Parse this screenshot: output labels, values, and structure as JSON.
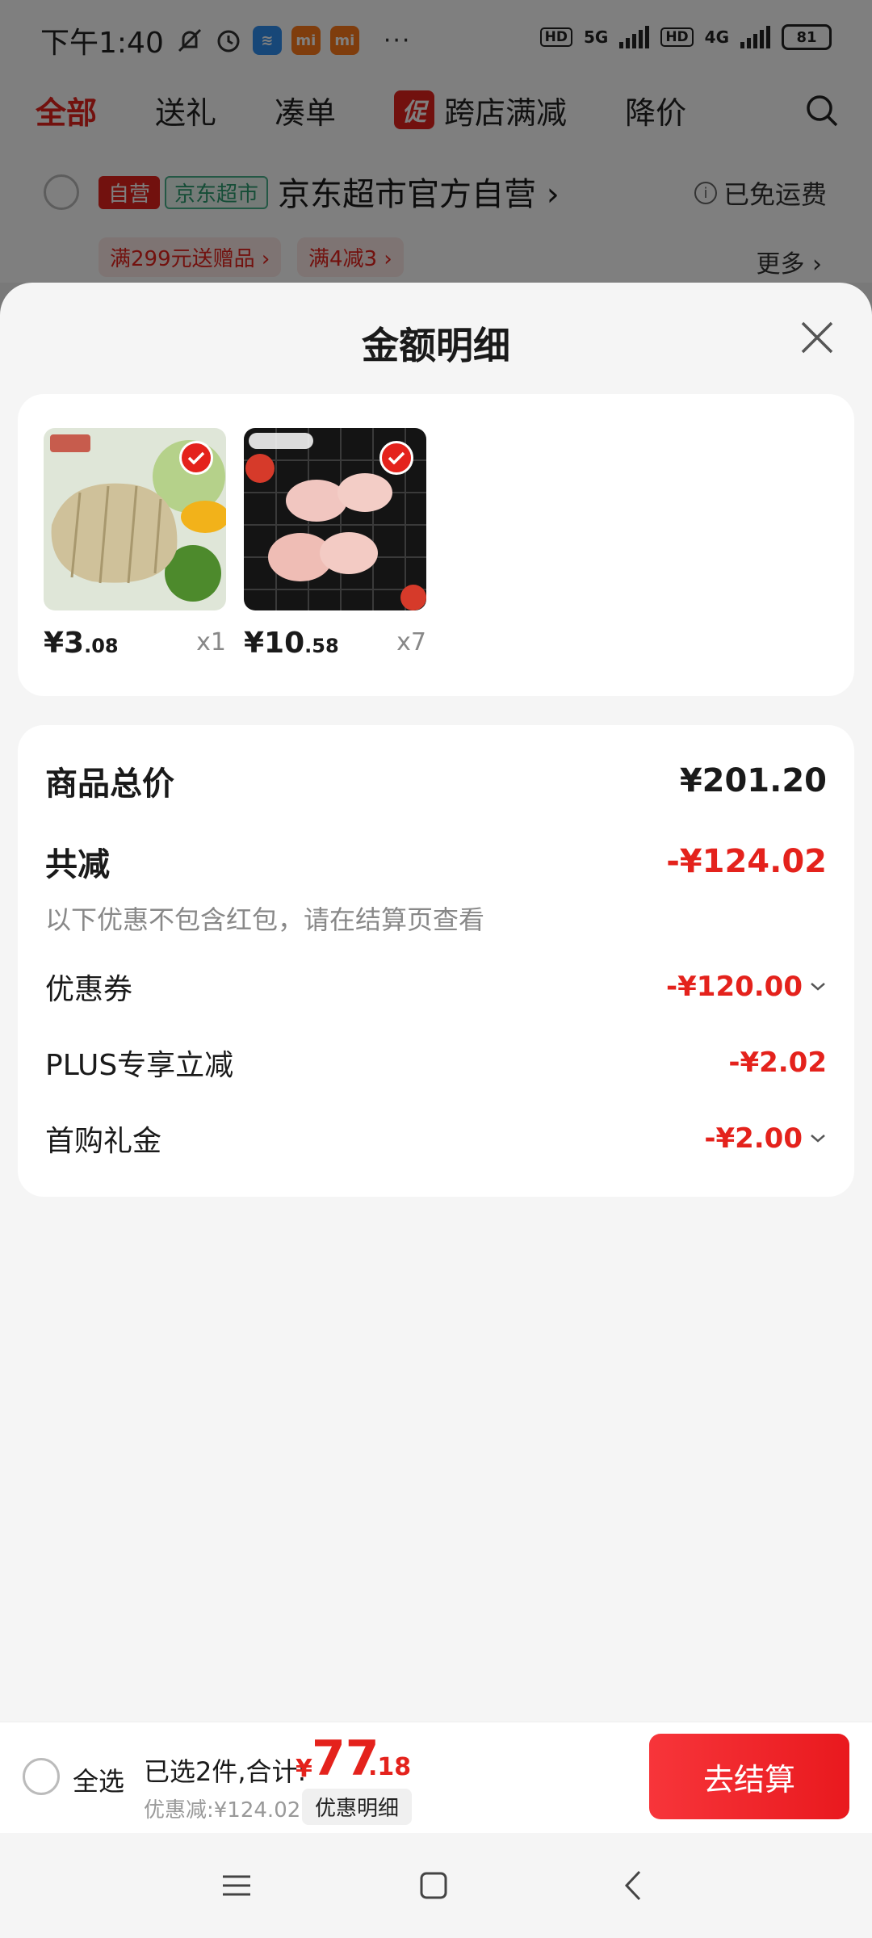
{
  "status_bar": {
    "time": "下午1:40",
    "icons": [
      "mute-bell-icon",
      "alarm-icon",
      "app-stack-icon",
      "mi-icon",
      "mi-icon"
    ],
    "overflow": "···",
    "network_1": "5G",
    "network_2": "4G",
    "hd": "HD",
    "battery": "81"
  },
  "tabs": [
    {
      "label": "全部",
      "active": true
    },
    {
      "label": "送礼"
    },
    {
      "label": "凑单"
    },
    {
      "badge": "促",
      "label": "跨店满减"
    },
    {
      "label": "降价"
    }
  ],
  "store": {
    "tag_self": "自营",
    "tag_market": "京东超市",
    "name": "京东超市官方自营",
    "free_shipping": "已免运费",
    "promo_1": "满299元送赠品",
    "promo_2": "满4减3",
    "more": "更多"
  },
  "sheet": {
    "title": "金额明细",
    "products": [
      {
        "price_int": "¥3",
        "price_dec": ".08",
        "qty": "x1"
      },
      {
        "price_int": "¥10",
        "price_dec": ".58",
        "qty": "x7"
      }
    ],
    "summary": {
      "total_label": "商品总价",
      "total_value": "¥201.20",
      "discount_label": "共减",
      "discount_value": "-¥124.02",
      "hint": "以下优惠不包含红包，请在结算页查看",
      "items": [
        {
          "label": "优惠券",
          "value": "-¥120.00",
          "expandable": true
        },
        {
          "label": "PLUS专享立减",
          "value": "-¥2.02",
          "expandable": false
        },
        {
          "label": "首购礼金",
          "value": "-¥2.00",
          "expandable": true
        }
      ]
    }
  },
  "bottom_bar": {
    "select_all": "全选",
    "selected_text": "已选2件,合计:",
    "currency": "¥",
    "total_int": "77",
    "total_dec": ".18",
    "discount_text": "优惠减:¥124.02",
    "detail_button": "优惠明细",
    "checkout_button": "去结算"
  },
  "colors": {
    "accent": "#e4221c",
    "green_tag": "#2b9a6e"
  }
}
